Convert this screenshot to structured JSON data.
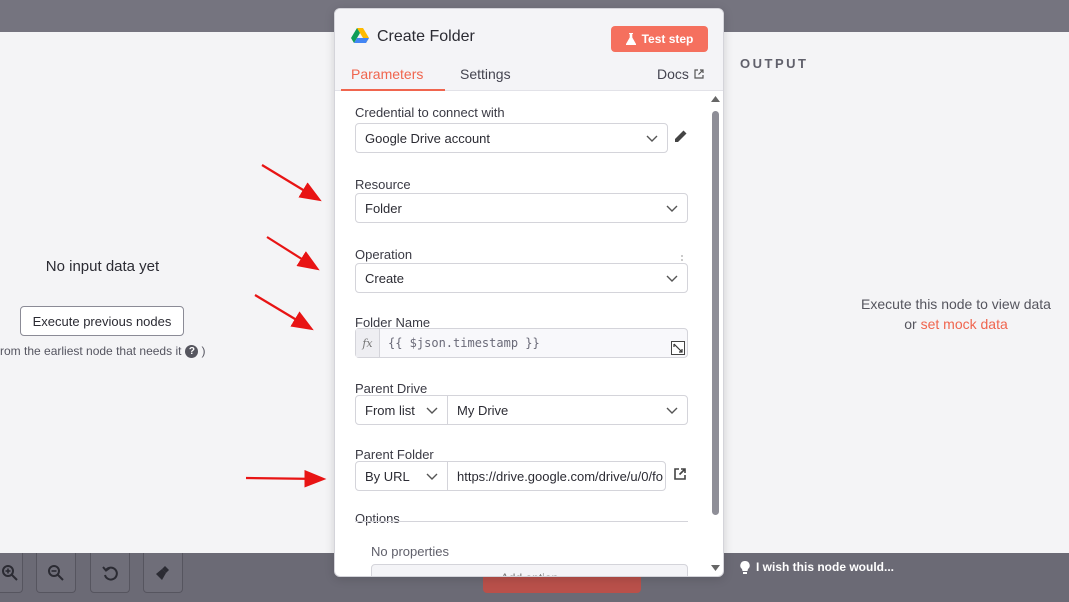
{
  "left_panel": {
    "title": "No input data yet",
    "execute_button": "Execute previous nodes",
    "note": "rom the earliest node that needs it",
    "note_suffix": ")"
  },
  "right_panel": {
    "label": "OUTPUT",
    "hint_line1": "Execute this node to view data",
    "hint_or": "or",
    "hint_link": "set mock data"
  },
  "modal": {
    "title": "Create Folder",
    "test_step": "Test step",
    "tabs": {
      "parameters": "Parameters",
      "settings": "Settings",
      "docs": "Docs"
    },
    "fields": {
      "credential": {
        "label": "Credential to connect with",
        "value": "Google Drive account"
      },
      "resource": {
        "label": "Resource",
        "value": "Folder"
      },
      "operation": {
        "label": "Operation",
        "value": "Create"
      },
      "folder_name": {
        "label": "Folder Name",
        "fx": "fx",
        "value": "{{ $json.timestamp }}"
      },
      "parent_drive": {
        "label": "Parent Drive",
        "mode": "From list",
        "value": "My Drive"
      },
      "parent_folder": {
        "label": "Parent Folder",
        "mode": "By URL",
        "value": "https://drive.google.com/drive/u/0/fo"
      },
      "options": {
        "label": "Options",
        "empty": "No properties",
        "add_button": "Add option"
      }
    }
  },
  "bottom": {
    "wish": "I wish this node would..."
  },
  "colors": {
    "accent": "#f0654e",
    "test_button": "#f5705e",
    "overlay": "#7b7a86",
    "panel_bg": "#f4f4f6"
  },
  "icons": [
    "google-drive-icon",
    "flask-icon",
    "external-link-icon",
    "chevron-down-icon",
    "pencil-icon",
    "kebab-icon",
    "expand-icon",
    "zoom-in-icon",
    "zoom-out-icon",
    "undo-icon",
    "broom-icon",
    "lightbulb-icon",
    "question-icon"
  ]
}
